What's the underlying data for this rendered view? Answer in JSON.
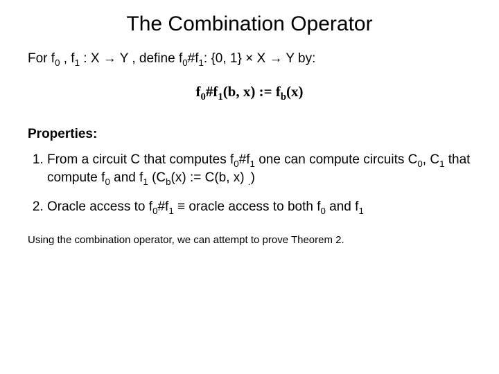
{
  "title": "The Combination Operator",
  "line1_a": "For f",
  "line1_b": " , f",
  "line1_c": " : X ",
  "line1_arrow1": "→",
  "line1_d": " Y , define f",
  "line1_e": "#f",
  "line1_f": ": {0, 1} × X ",
  "line1_arrow2": "→",
  "line1_g": " Y by:",
  "eqn_a": "f",
  "eqn_b": "#f",
  "eqn_c": "(b, x) := f",
  "eqn_d": "(x)",
  "props_label": "Properties:",
  "item1_a": "From a circuit C that computes f",
  "item1_b": "#f",
  "item1_c": "  one can compute circuits C",
  "item1_d": ", C",
  "item1_e": " that compute f",
  "item1_f": " and f",
  "item1_g": " (C",
  "item1_h": "(x) := C(b, x) ",
  "item1_i": ")",
  "item2_a": "Oracle access to f",
  "item2_b": "#f",
  "item2_c": " ≡ oracle access to both f",
  "item2_d": " and f",
  "footnote": "Using the combination operator, we can attempt to prove Theorem 2.",
  "sub0": "0",
  "sub1": "1",
  "subb": "b"
}
